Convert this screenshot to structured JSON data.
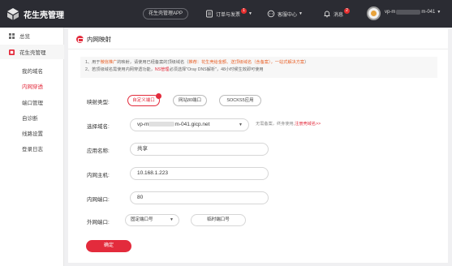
{
  "header": {
    "brand_title": "花生壳管理",
    "app_button": "花生壳管理APP",
    "orders_label": "订单与发票",
    "orders_badge": "1",
    "service_label": "客服中心",
    "news_label": "消息",
    "news_badge": "2",
    "user_prefix": "vp-m",
    "user_suffix": "m-041"
  },
  "sidebar": {
    "overview": "总览",
    "section": "花生壳管理",
    "items": [
      "我的域名",
      "内网穿透",
      "端口管理",
      "自诊断",
      "线路设置",
      "登录日志"
    ],
    "active_index": 1
  },
  "page": {
    "title": "内网映射",
    "notice_1_pre": "1、用于",
    "notice_1_hl1": "微信推广",
    "notice_1_mid": "的映射，请使用已经备案的顶级域名（",
    "notice_1_hl2": "推荐：花生壳给金额、送顶级域名（含备案），一站式解决方案",
    "notice_1_end": "）",
    "notice_2_pre": "2、若顶级域名需使用内网穿透功能，",
    "notice_2_hl": "NS管理",
    "notice_2_end": "必须选择\"Oray DNS解析\"，48小时候生效即可使用",
    "labels": {
      "type": "映射类型:",
      "domain": "选择域名:",
      "app_name": "应用名称:",
      "host": "内网主机:",
      "port": "内网端口:",
      "ext_port": "外网端口:"
    },
    "types": [
      "自定义端口",
      "网站80端口",
      "SOCKS5应用"
    ],
    "selected_type": 0,
    "domain_prefix": "vp-m",
    "domain_suffix": "m-041.gicp.net",
    "domain_hint_pre": "无需备案，终身使用,",
    "domain_hint_link": "注册壳域名>>",
    "app_name": "共享",
    "host": "10.168.1.223",
    "port": "80",
    "ext_port_select": "固定端口号",
    "ext_port_temp": "临时端口号",
    "confirm": "确定"
  },
  "colors": {
    "accent": "#e32b3c",
    "topbar": "#2b2c33",
    "highlight": "#e8622a"
  }
}
